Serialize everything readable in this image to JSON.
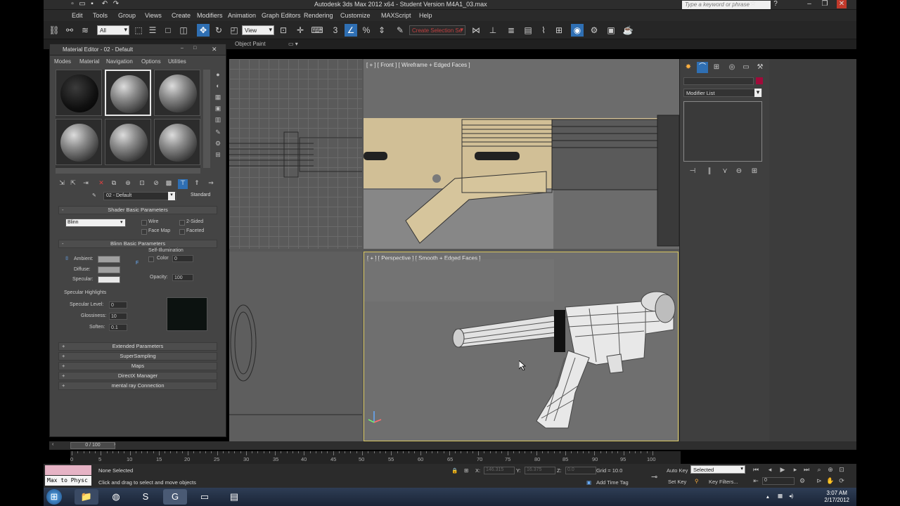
{
  "window": {
    "title": "Autodesk 3ds Max 2012 x64  -  Student Version    M4A1_03.max",
    "search_placeholder": "Type a keyword or phrase"
  },
  "menubar": [
    "Edit",
    "Tools",
    "Group",
    "Views",
    "Create",
    "Modifiers",
    "Animation",
    "Graph Editors",
    "Rendering",
    "Customize",
    "MAXScript",
    "Help"
  ],
  "toolbar": {
    "filter_value": "All",
    "refcoord_value": "View",
    "selection_set_value": "Create Selection Se"
  },
  "ribbon": {
    "label": "Object Paint"
  },
  "material_editor": {
    "title": "Material Editor - 02 - Default",
    "menu": [
      "Modes",
      "Material",
      "Navigation",
      "Options",
      "Utilities"
    ],
    "material_name": "02 - Default",
    "material_type": "Standard",
    "shader_rollout": "Shader Basic Parameters",
    "shader_value": "Blinn",
    "wire_label": "Wire",
    "two_sided_label": "2-Sided",
    "face_map_label": "Face Map",
    "faceted_label": "Faceted",
    "blinn_rollout": "Blinn Basic Parameters",
    "self_illum_label": "Self-Illumination",
    "ambient_label": "Ambient:",
    "diffuse_label": "Diffuse:",
    "specular_label": "Specular:",
    "color_label": "Color",
    "color_value": "0",
    "opacity_label": "Opacity:",
    "opacity_value": "100",
    "spec_highlights_label": "Specular Highlights",
    "spec_level_label": "Specular Level:",
    "spec_level_value": "0",
    "glossiness_label": "Glossiness:",
    "glossiness_value": "10",
    "soften_label": "Soften:",
    "soften_value": "0.1",
    "rollouts": [
      "Extended Parameters",
      "SuperSampling",
      "Maps",
      "DirectX Manager",
      "mental ray Connection"
    ]
  },
  "viewports": {
    "front_label": "[ + ] [ Front ] [ Wireframe + Edged Faces ]",
    "perspective_label": "[ + ] [ Perspective ] [ Smooth + Edged Faces ]"
  },
  "command_panel": {
    "modifier_list": "Modifier List"
  },
  "timeline": {
    "slider_label": "0 / 100",
    "ticks": [
      "0",
      "5",
      "10",
      "15",
      "20",
      "25",
      "30",
      "35",
      "40",
      "45",
      "50",
      "55",
      "60",
      "65",
      "70",
      "75",
      "80",
      "85",
      "90",
      "95",
      "100"
    ]
  },
  "statusbar": {
    "listener_text": "Max to Physc",
    "selection_status": "None Selected",
    "prompt": "Click and drag to select and move objects",
    "x_label": "X:",
    "y_label": "Y:",
    "z_label": "Z:",
    "x_value": "146.315",
    "y_value": "16.375",
    "z_value": "0.0",
    "grid": "Grid = 10.0",
    "add_time_tag": "Add Time Tag",
    "auto_key": "Auto Key",
    "set_key": "Set Key",
    "selected_value": "Selected",
    "key_filters": "Key Filters...",
    "frame_value": "0"
  },
  "taskbar": {
    "time": "3:07 AM",
    "date": "2/17/2012"
  },
  "colors": {
    "accent_blue": "#2f6fb3",
    "active_viewport_border": "#d9c760",
    "object_color": "#a00b3a"
  }
}
